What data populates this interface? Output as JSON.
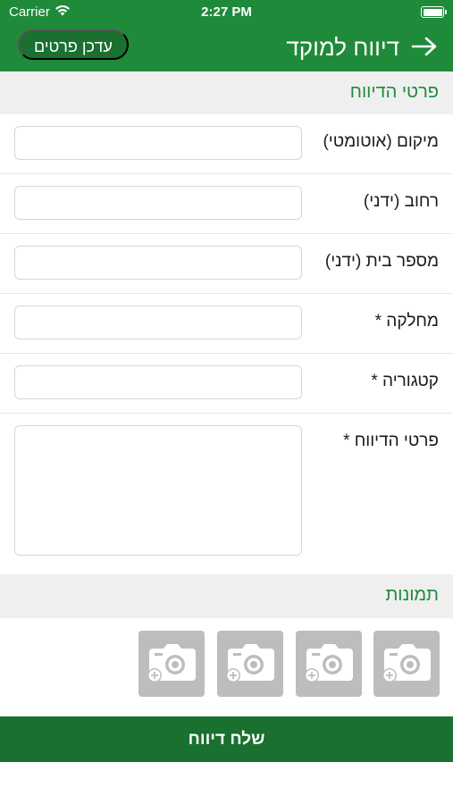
{
  "status_bar": {
    "carrier": "Carrier",
    "time": "2:27 PM",
    "icons": [
      "wifi-icon",
      "battery-icon"
    ]
  },
  "nav": {
    "title": "דיווח למוקד",
    "update_button": "עדכן פרטים",
    "back_icon": "arrow-right-icon"
  },
  "report_section": {
    "title": "פרטי הדיווח",
    "fields": [
      {
        "label": "מיקום (אוטומטי)",
        "value": ""
      },
      {
        "label": "רחוב (ידני)",
        "value": ""
      },
      {
        "label": "מספר בית (ידני)",
        "value": ""
      },
      {
        "label": "מחלקה *",
        "value": ""
      },
      {
        "label": "קטגוריה *",
        "value": ""
      },
      {
        "label": "פרטי הדיווח *",
        "value": ""
      }
    ]
  },
  "photos_section": {
    "title": "תמונות",
    "slots": [
      "add-photo-icon",
      "add-photo-icon",
      "add-photo-icon",
      "add-photo-icon"
    ]
  },
  "submit_button": "שלח דיווח",
  "colors": {
    "primary": "#1f8a3a",
    "primary_dark": "#19702f",
    "section_bg": "#efefef",
    "photo_placeholder": "#bdbdbd"
  }
}
